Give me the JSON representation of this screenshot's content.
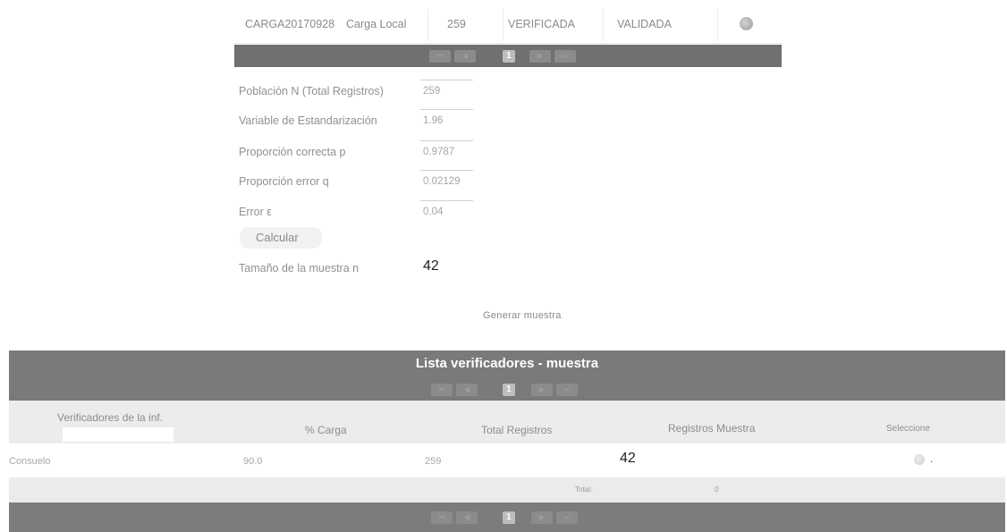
{
  "top_row": {
    "code": "CARGA20170928",
    "type": "Carga Local",
    "count": "259",
    "status1": "VERIFICADA",
    "status2": "VALIDADA"
  },
  "pager": {
    "first": "⏮",
    "prev": "◀",
    "current": "1",
    "next": "▶",
    "last": "⏭"
  },
  "form": {
    "poblacion_label": "Población N (Total Registros)",
    "poblacion_value": "259",
    "variable_label": "Variable de Estandarización",
    "variable_value": "1.96",
    "prop_correcta_label": "Proporción correcta p",
    "prop_correcta_value": "0.9787",
    "prop_error_label": "Proporción error q",
    "prop_error_value": "0.02129",
    "error_label": "Error ε",
    "error_value": "0.04",
    "calcular_button": "Calcular",
    "muestra_label": "Tamaño de la muestra n",
    "muestra_value": "42"
  },
  "generar_muestra": "Generar muestra",
  "list": {
    "title": "Lista verificadores - muestra",
    "headers": {
      "verificadores": "Verificadores de la inf.",
      "carga": "% Carga",
      "total_registros": "Total Registros",
      "registros_muestra": "Registros Muestra",
      "seleccione": "Seleccione"
    },
    "rows": [
      {
        "verificador": "Consuelo",
        "carga": "90.0",
        "total": "259",
        "muestra": "42",
        "mark": "."
      }
    ],
    "total_label": "Total:",
    "total_value": "0"
  }
}
